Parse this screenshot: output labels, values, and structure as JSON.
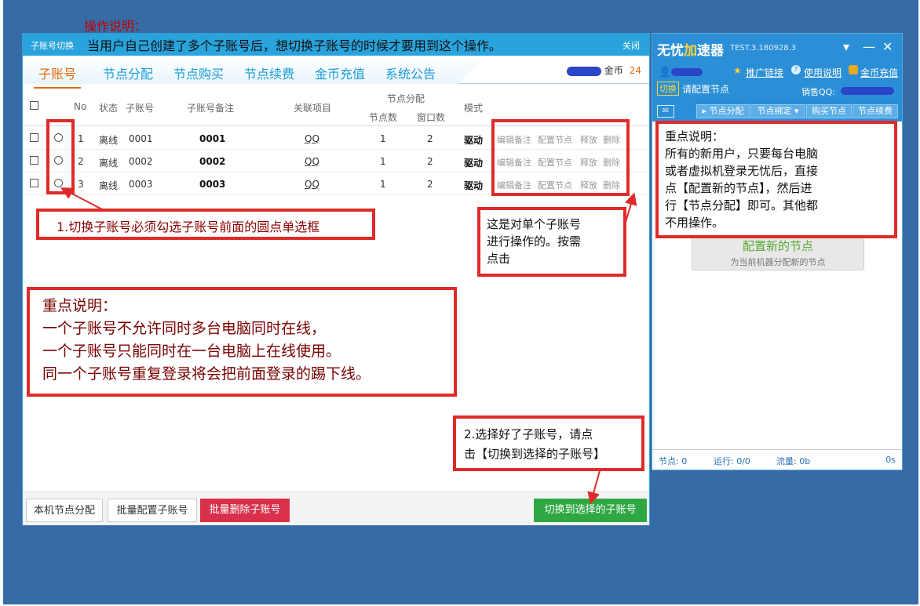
{
  "op_title": "操作说明：",
  "main": {
    "title": "子账号切换",
    "subtitle": "当用户自己创建了多个子账号后，想切换子账号的时候才要用到这个操作。",
    "close": "关闭",
    "tabs": [
      "子账号",
      "节点分配",
      "节点购买",
      "节点续费",
      "金币充值",
      "系统公告"
    ],
    "gold_label": "金币",
    "gold_value": "24",
    "headers": {
      "no": "No",
      "status": "状态",
      "account": "子账号",
      "remark": "子账号备注",
      "project": "关联项目",
      "node_alloc": "节点分配",
      "node_count": "节点数",
      "window_count": "窗口数",
      "mode": "模式"
    },
    "rows": [
      {
        "no": "1",
        "status": "离线",
        "account": "0001",
        "remark": "0001",
        "project": "QQ",
        "nodes": "1",
        "windows": "2",
        "mode": "驱动"
      },
      {
        "no": "2",
        "status": "离线",
        "account": "0002",
        "remark": "0002",
        "project": "QQ",
        "nodes": "1",
        "windows": "2",
        "mode": "驱动"
      },
      {
        "no": "3",
        "status": "离线",
        "account": "0003",
        "remark": "0003",
        "project": "QQ",
        "nodes": "1",
        "windows": "2",
        "mode": "驱动"
      }
    ],
    "actions": [
      "编辑备注",
      "配置节点",
      "释放",
      "删除"
    ],
    "buttons": {
      "local": "本机节点分配",
      "batch_config": "批量配置子账号",
      "batch_delete": "批量删除子账号",
      "switch": "切换到选择的子账号"
    }
  },
  "annotations": {
    "step1": "1.切换子账号必须勾选子账号前面的圆点单选框",
    "single": [
      "这是对单个子账号",
      "进行操作的。按需",
      "点击"
    ],
    "key_left": [
      "重点说明：",
      "一个子账号不允许同时多台电脑同时在线，",
      "一个子账号只能同时在一台电脑上在线使用。",
      "同一个子账号重复登录将会把前面登录的踢下线。"
    ],
    "step2": [
      "2.选择好了子账号，请点",
      "击【切换到选择的子账号】"
    ],
    "key_right": [
      "重点说明：",
      "所有的新用户，只要每台电脑",
      "或者虚拟机登录无忧后，直接",
      "点【配置新的节点】，然后进",
      "行【节点分配】即可。其他都",
      "不用操作。"
    ]
  },
  "right": {
    "logo_a": "无忧",
    "logo_b": "加",
    "logo_c": "速器",
    "version": "TEST.3.180928.3",
    "promo": "推广链接",
    "help": "使用说明",
    "recharge": "金币充值",
    "switch_tag": "切换",
    "config_hint": "请配置节点",
    "sales": "销售QQ:",
    "toolbar": [
      "▸ 节点分配",
      "节点绑定 ▾",
      "购买节点",
      "节点续费"
    ],
    "cfg_main": "配置新的节点",
    "cfg_sub": "为当前机器分配新的节点",
    "status": {
      "nodes": "节点: 0",
      "running": "运行: 0/0",
      "traffic": "流量: 0b",
      "time": "0s"
    }
  }
}
